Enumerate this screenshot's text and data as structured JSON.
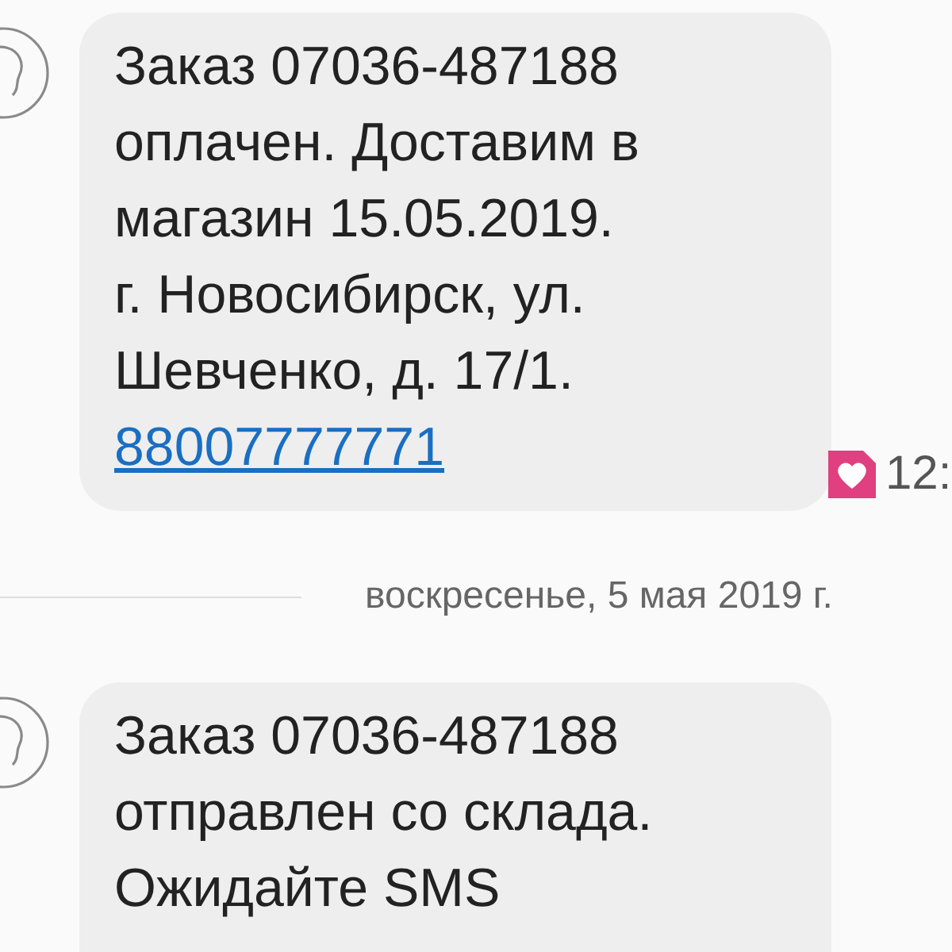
{
  "messages": [
    {
      "text": "Заказ 07036-487188\nоплачен. Доставим в\nмагазин 15.05.2019.\nг. Новосибирск, ул.\nШевченко, д. 17/1.",
      "link": "88007777771",
      "time": "12:"
    }
  ],
  "date_separator": "воскресенье, 5 мая 2019 г.",
  "later_messages": [
    {
      "text": "Заказ 07036-487188\nотправлен со склада.\nОжидайте SMS"
    }
  ]
}
